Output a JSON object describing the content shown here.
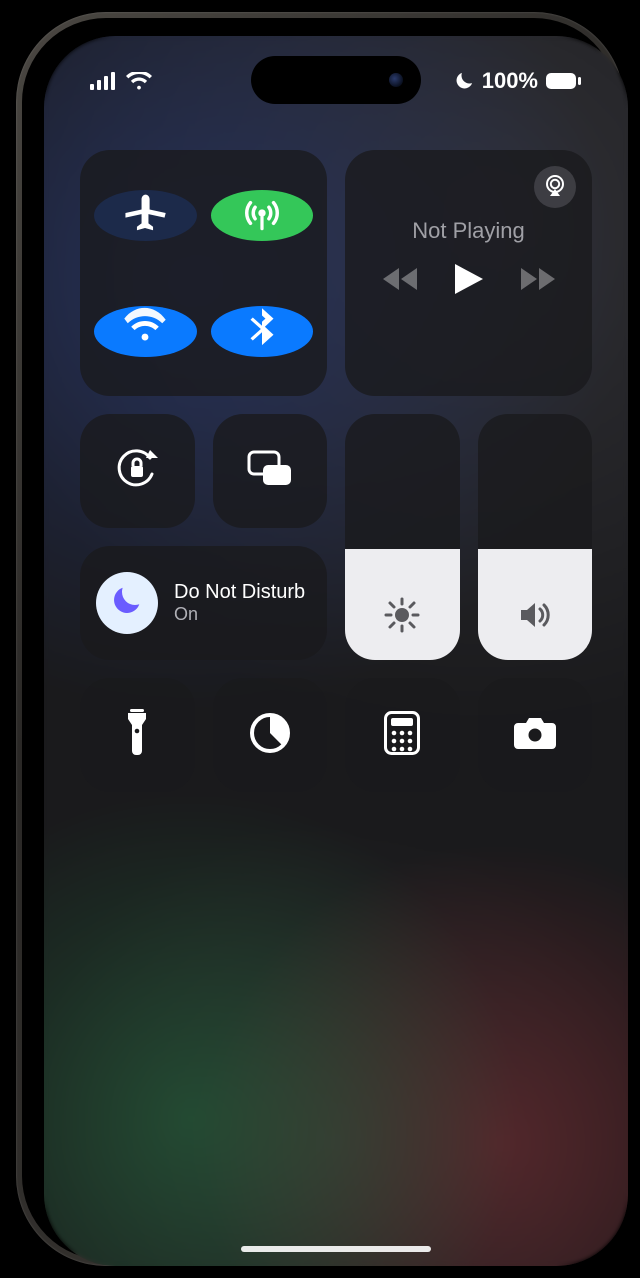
{
  "status": {
    "battery_percent": "100%",
    "focus_indicator": "do-not-disturb"
  },
  "connectivity": {
    "airplane_on": false,
    "cellular_on": true,
    "wifi_on": true,
    "bluetooth_on": true
  },
  "media": {
    "title": "Not Playing"
  },
  "focus": {
    "title": "Do Not Disturb",
    "status": "On",
    "active": true
  },
  "sliders": {
    "brightness_percent": 45,
    "volume_percent": 45
  },
  "colors": {
    "toggle_on_green": "#34c759",
    "toggle_on_blue": "#0a7aff",
    "tile_bg": "rgba(25,25,28,.78)",
    "focus_badge_bg": "#e4f0ff",
    "focus_badge_icon": "#6a5cff"
  },
  "icons": {
    "airplane": "airplane-icon",
    "cellular": "antenna-icon",
    "wifi": "wifi-icon",
    "bluetooth": "bluetooth-icon",
    "airplay": "airplay-icon",
    "prev": "backward-icon",
    "play": "play-icon",
    "next": "forward-icon",
    "orientation_lock": "orientation-lock-icon",
    "screen_mirroring": "screen-mirroring-icon",
    "moon": "moon-icon",
    "brightness": "sun-icon",
    "volume": "speaker-icon",
    "flashlight": "flashlight-icon",
    "timer": "timer-icon",
    "calculator": "calculator-icon",
    "camera": "camera-icon"
  }
}
